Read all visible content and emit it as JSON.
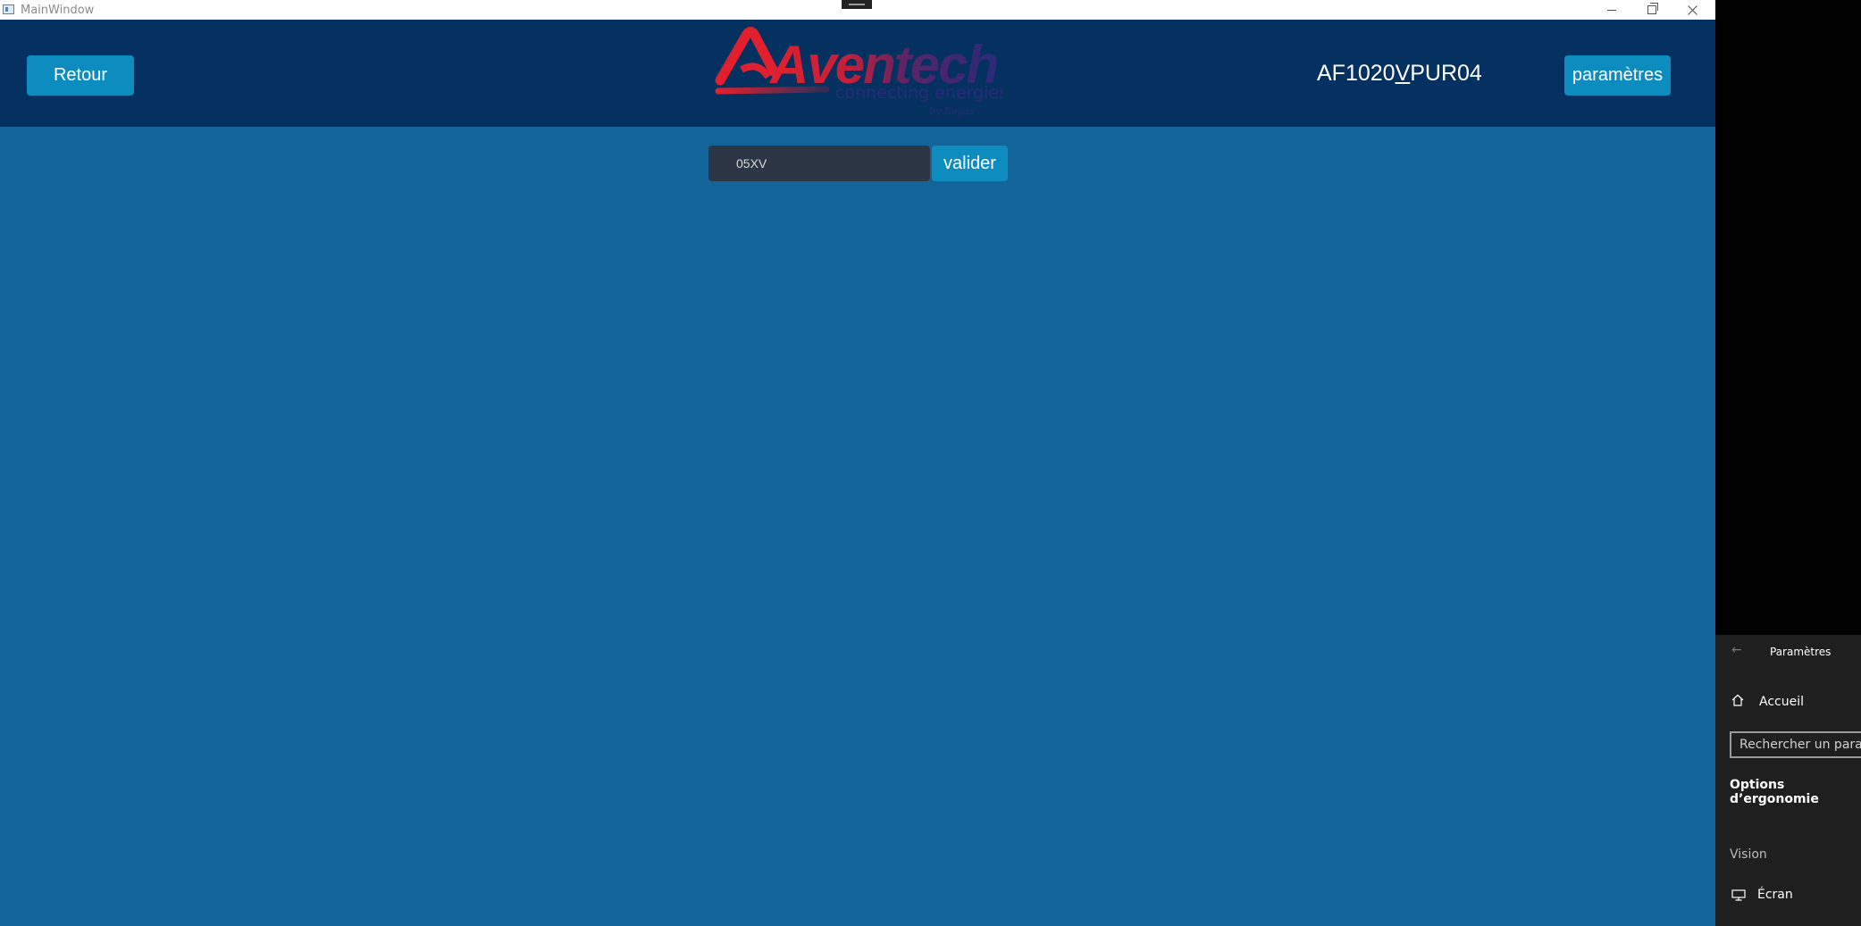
{
  "window": {
    "title": "MainWindow"
  },
  "header": {
    "back_label": "Retour",
    "device_id_start": "AF1020",
    "device_id_underlined": "V",
    "device_id_end": "PUR04",
    "settings_label": "paramètres",
    "logo": {
      "brand": "Aventech",
      "tagline": "connecting energies",
      "byline": "by Regas"
    }
  },
  "search": {
    "code_value": "05XV",
    "validate_label": "valider"
  },
  "settings_panel": {
    "title": "Paramètres",
    "home_label": "Accueil",
    "search_placeholder": "Rechercher un paramètre",
    "section_title": "Options d’ergonomie",
    "category_label": "Vision",
    "screen_label": "Écran"
  },
  "colors": {
    "main_bg": "#136498",
    "header_bg": "#04315f",
    "button": "#0d8cc0",
    "input_bg": "#2c3645",
    "logo_red": "#e0202e",
    "logo_navy": "#2a2a7a",
    "panel_bg": "#1f1f1f"
  }
}
